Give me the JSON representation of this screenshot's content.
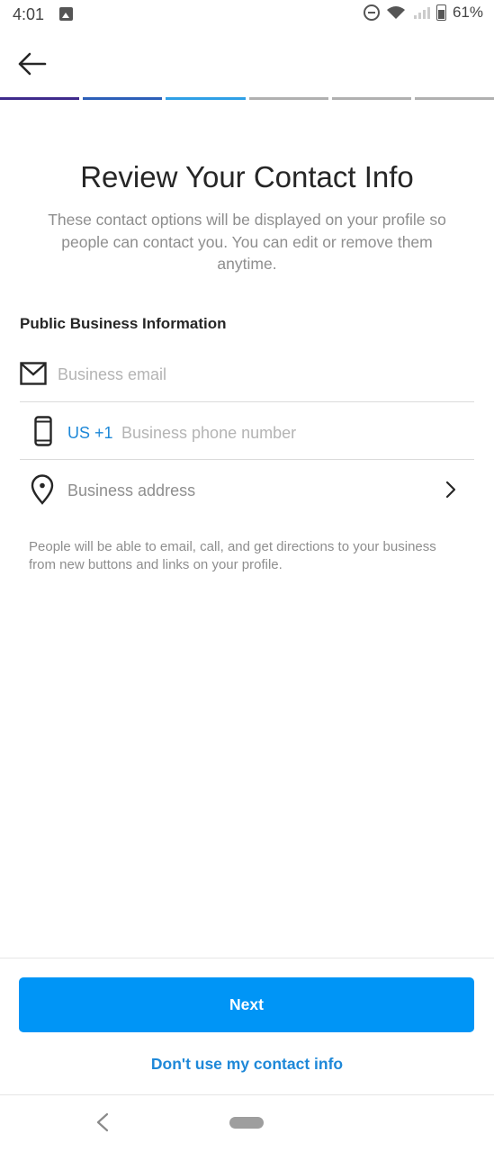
{
  "status_bar": {
    "time": "4:01",
    "battery": "61%"
  },
  "progress": {
    "total_steps": 6,
    "active_steps": 3,
    "colors": [
      "#3f2a8c",
      "#2c5fb8",
      "#2ea0e6"
    ]
  },
  "header": {
    "title": "Review Your Contact Info",
    "subtitle": "These contact options will be displayed on your profile so people can contact you. You can edit or remove them anytime."
  },
  "form": {
    "section_title": "Public Business Information",
    "email": {
      "placeholder": "Business email",
      "value": ""
    },
    "phone": {
      "country_code": "US +1",
      "placeholder": "Business phone number",
      "value": ""
    },
    "address": {
      "label": "Business address"
    },
    "helper": "People will be able to email, call, and get directions to your business from new buttons and links on your profile."
  },
  "actions": {
    "next": "Next",
    "skip": "Don't use my contact info"
  },
  "theme": {
    "accent": "#0095f6",
    "link": "#1e88d8"
  }
}
